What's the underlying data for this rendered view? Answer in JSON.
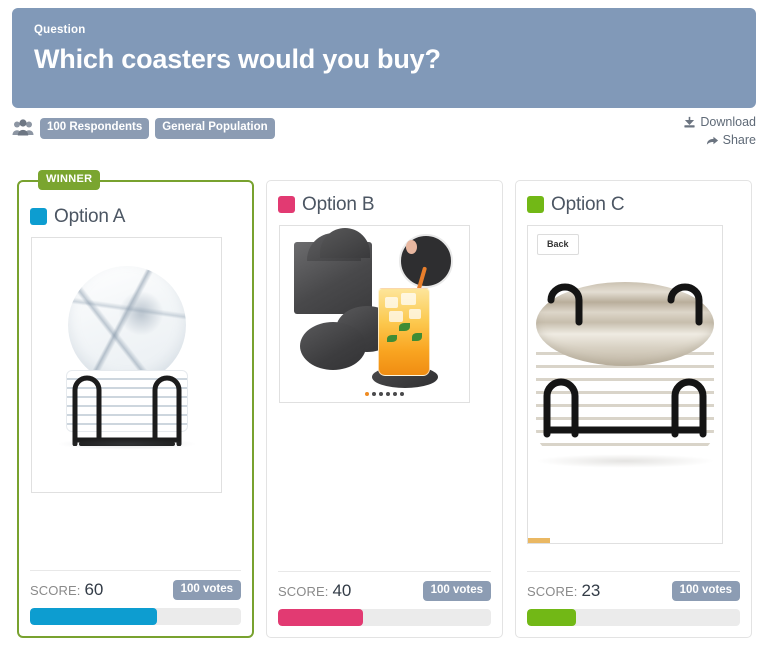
{
  "header": {
    "eyebrow": "Question",
    "title": "Which coasters would you buy?",
    "background_color": "#8199b8"
  },
  "meta": {
    "people_icon": "people-group-icon",
    "respondents_pill": "100 Respondents",
    "audience_pill": "General Population",
    "download_label": "Download",
    "download_icon": "download-icon",
    "share_label": "Share",
    "share_icon": "share-arrow-icon"
  },
  "winner_badge": "WINNER",
  "cards": [
    {
      "id": "option-a",
      "title": "Option A",
      "swatch_color": "#0d9dd0",
      "is_winner": true,
      "score_label": "SCORE:",
      "score_value": "60",
      "score_percent": 60,
      "votes_pill": "100 votes",
      "bar_color": "#0d9dd0",
      "image_alt": "white-marble-coaster-set-in-black-wire-holder"
    },
    {
      "id": "option-b",
      "title": "Option B",
      "swatch_color": "#e23a72",
      "is_winner": false,
      "score_label": "SCORE:",
      "score_value": "40",
      "score_percent": 40,
      "votes_pill": "100 votes",
      "bar_color": "#e23a72",
      "image_alt": "dark-gray-felt-coasters-with-holder-and-iced-drink",
      "carousel_dots": 6,
      "carousel_active_index": 0,
      "carousel_active_color": "#ef8b22"
    },
    {
      "id": "option-c",
      "title": "Option C",
      "swatch_color": "#72b816",
      "is_winner": false,
      "score_label": "SCORE:",
      "score_value": "23",
      "score_percent": 23,
      "votes_pill": "100 votes",
      "bar_color": "#72b816",
      "image_alt": "beige-marble-coaster-stack-in-black-wire-holder",
      "back_button_label": "Back",
      "progress_color": "#eab863"
    }
  ]
}
